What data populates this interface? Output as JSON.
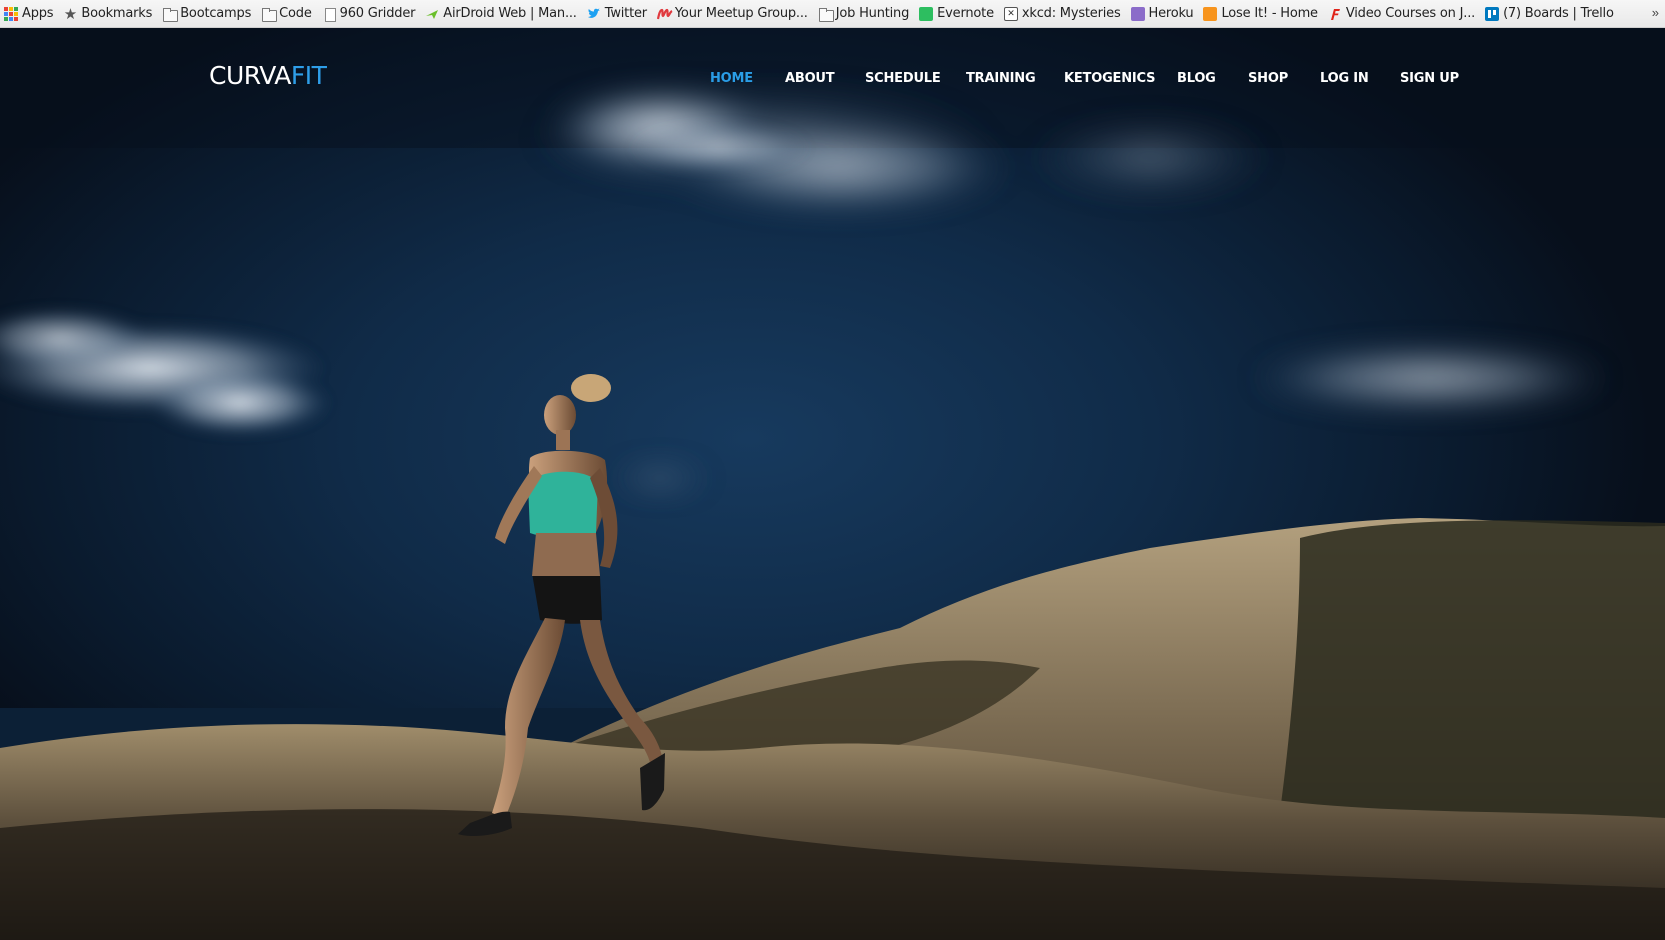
{
  "bookmarks_bar": {
    "items": [
      {
        "label": "Apps",
        "icon": "apps-grid-icon"
      },
      {
        "label": "Bookmarks",
        "icon": "star-icon"
      },
      {
        "label": "Bootcamps",
        "icon": "folder-icon"
      },
      {
        "label": "Code",
        "icon": "folder-icon"
      },
      {
        "label": "960 Gridder",
        "icon": "page-icon"
      },
      {
        "label": "AirDroid Web | Man...",
        "icon": "airdroid-icon"
      },
      {
        "label": "Twitter",
        "icon": "twitter-bird-icon"
      },
      {
        "label": "Your Meetup Group...",
        "icon": "meetup-icon"
      },
      {
        "label": "Job Hunting",
        "icon": "folder-icon"
      },
      {
        "label": "Evernote",
        "icon": "evernote-icon"
      },
      {
        "label": "xkcd: Mysteries",
        "icon": "xkcd-icon"
      },
      {
        "label": "Heroku",
        "icon": "heroku-icon"
      },
      {
        "label": "Lose It! - Home",
        "icon": "loseit-icon"
      },
      {
        "label": "Video Courses on J...",
        "icon": "video-courses-icon"
      },
      {
        "label": "(7) Boards | Trello",
        "icon": "trello-icon"
      }
    ],
    "overflow_glyph": "»"
  },
  "site": {
    "logo_part1": "CURVA",
    "logo_part2": "FIT",
    "accent_color": "#2a9de6",
    "nav": [
      {
        "label": "HOME",
        "active": true
      },
      {
        "label": "ABOUT",
        "active": false
      },
      {
        "label": "SCHEDULE",
        "active": false
      },
      {
        "label": "TRAINING",
        "active": false
      },
      {
        "label": "KETOGENICS",
        "active": false
      },
      {
        "label": "BLOG",
        "active": false
      },
      {
        "label": "SHOP",
        "active": false
      },
      {
        "label": "LOG IN",
        "active": false
      },
      {
        "label": "SIGN UP",
        "active": false
      }
    ]
  }
}
